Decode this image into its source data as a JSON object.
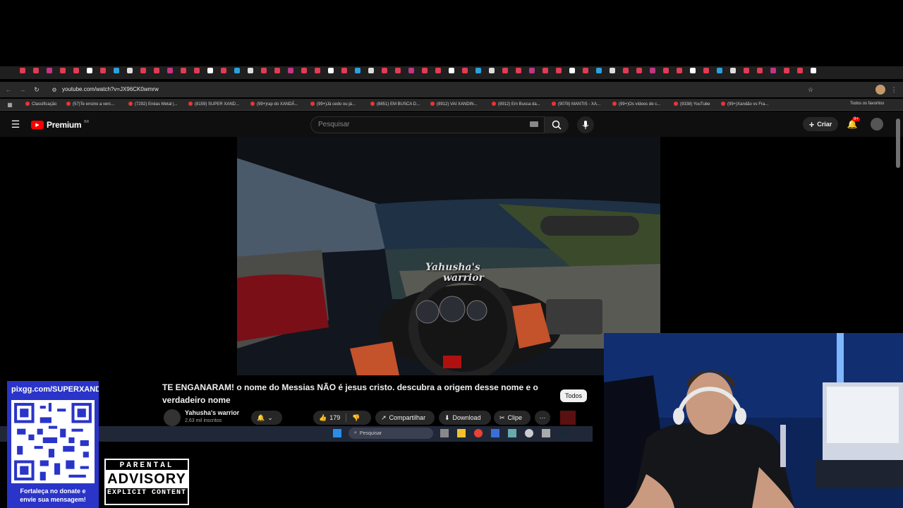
{
  "browser": {
    "url": "youtube.com/watch?v=JX96CK0wmrw",
    "bookmarks": [
      "Classificação",
      "(57)Te ensino a verc...",
      "(7292) Enéas Metal |...",
      "(8159) SUPER XAND...",
      "(99+)rap do XANDÃ...",
      "(99+)Já cedo ou já...",
      "(8851) EM BUSCA D...",
      "(8912) VAI XANDIN...",
      "(8912) Em Busca da...",
      "(9078) MANTIS - XA...",
      "(99+)Os vídeos de c...",
      "(9338) YouTube",
      "(99+)Xandão vs Fra..."
    ],
    "all_bookmarks": "Todos os favoritos"
  },
  "youtube": {
    "logo": "Premium",
    "logo_badge": "BR",
    "search_placeholder": "Pesquisar",
    "create_label": "Criar",
    "notif_badge": "9+"
  },
  "video": {
    "watermark_line1": "Yahusha's",
    "watermark_line2": "warrior",
    "title": "TE ENGANARAM! o nome do Messias NÃO é jesus cristo. descubra a origem desse nome e o verdadeiro nome",
    "channel": "Yahusha's warrior",
    "subscribers": "2,63 mil inscritos",
    "likes": "179",
    "share": "Compartilhar",
    "download": "Download",
    "clip": "Clipe",
    "chip": "Todos"
  },
  "taskbar": {
    "search": "Pesquisar"
  },
  "overlay": {
    "qr_url": "pixgg.com/SUPERXAND",
    "qr_caption_1": "Fortaleça no donate e",
    "qr_caption_2": "envie sua mensagem!",
    "advisory_1": "PARENTAL",
    "advisory_2": "ADVISORY",
    "advisory_3": "EXPLICIT CONTENT"
  },
  "colors": {
    "yt_red": "#ff0000",
    "qr_blue": "#2a34c9",
    "bg": "#000000"
  }
}
